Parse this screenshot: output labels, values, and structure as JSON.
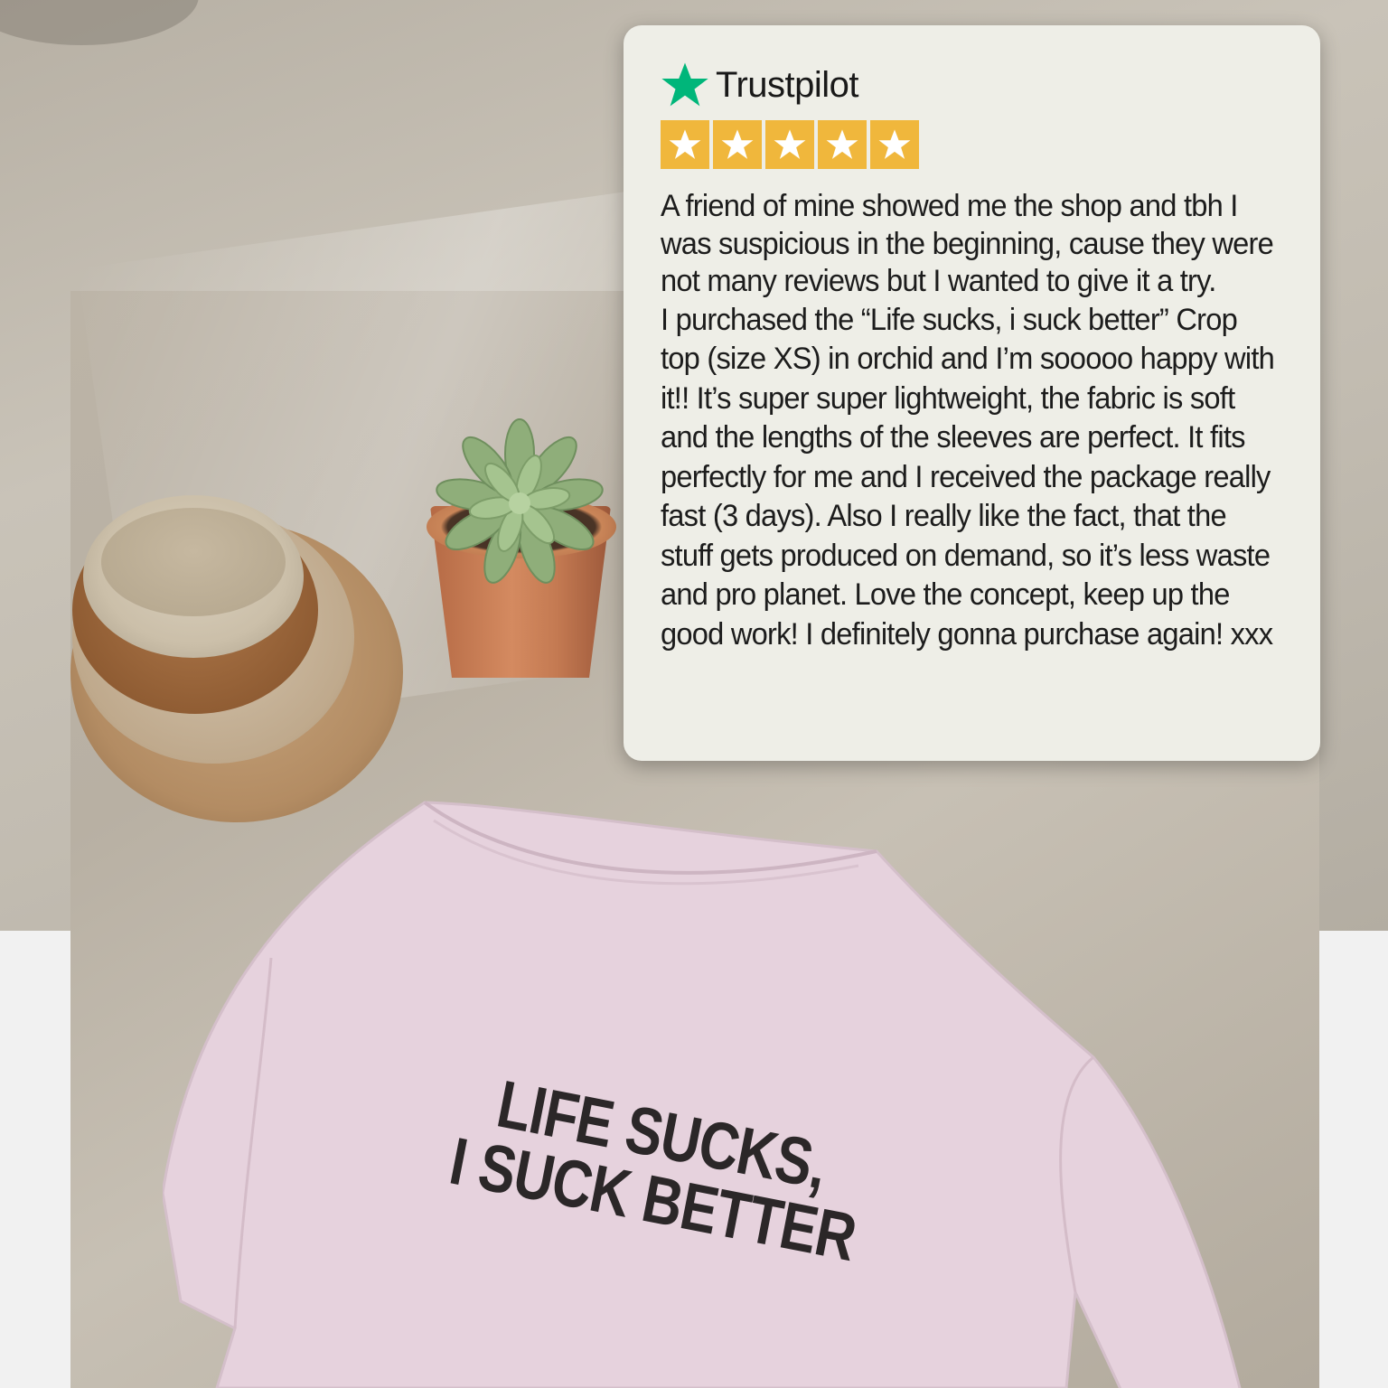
{
  "review_card": {
    "brand": "Trustpilot",
    "rating": 5,
    "rating_max": 5,
    "star_color": "#f0b73c",
    "brand_star_color": "#00b67a",
    "paragraph_1": "A friend of mine showed me the shop and tbh I was suspicious in the beginning, cause they were not many reviews but I wanted to give it a try.",
    "paragraph_2": "I purchased the “Life sucks, i suck better” Crop top (size XS) in orchid and I’m sooooo happy with it!! It’s super super lightweight, the fabric is soft and the lengths of the sleeves are perfect. It fits perfectly for me and I received the package really fast (3 days). Also I really like the fact, that the stuff gets produced on demand, so it’s less waste and pro planet. Love the concept, keep up the good work! I definitely gonna purchase again! xxx"
  },
  "product": {
    "print_line_1": "LIFE SUCKS,",
    "print_line_2": "I SUCK BETTER",
    "shirt_color": "#e6d2dd"
  }
}
